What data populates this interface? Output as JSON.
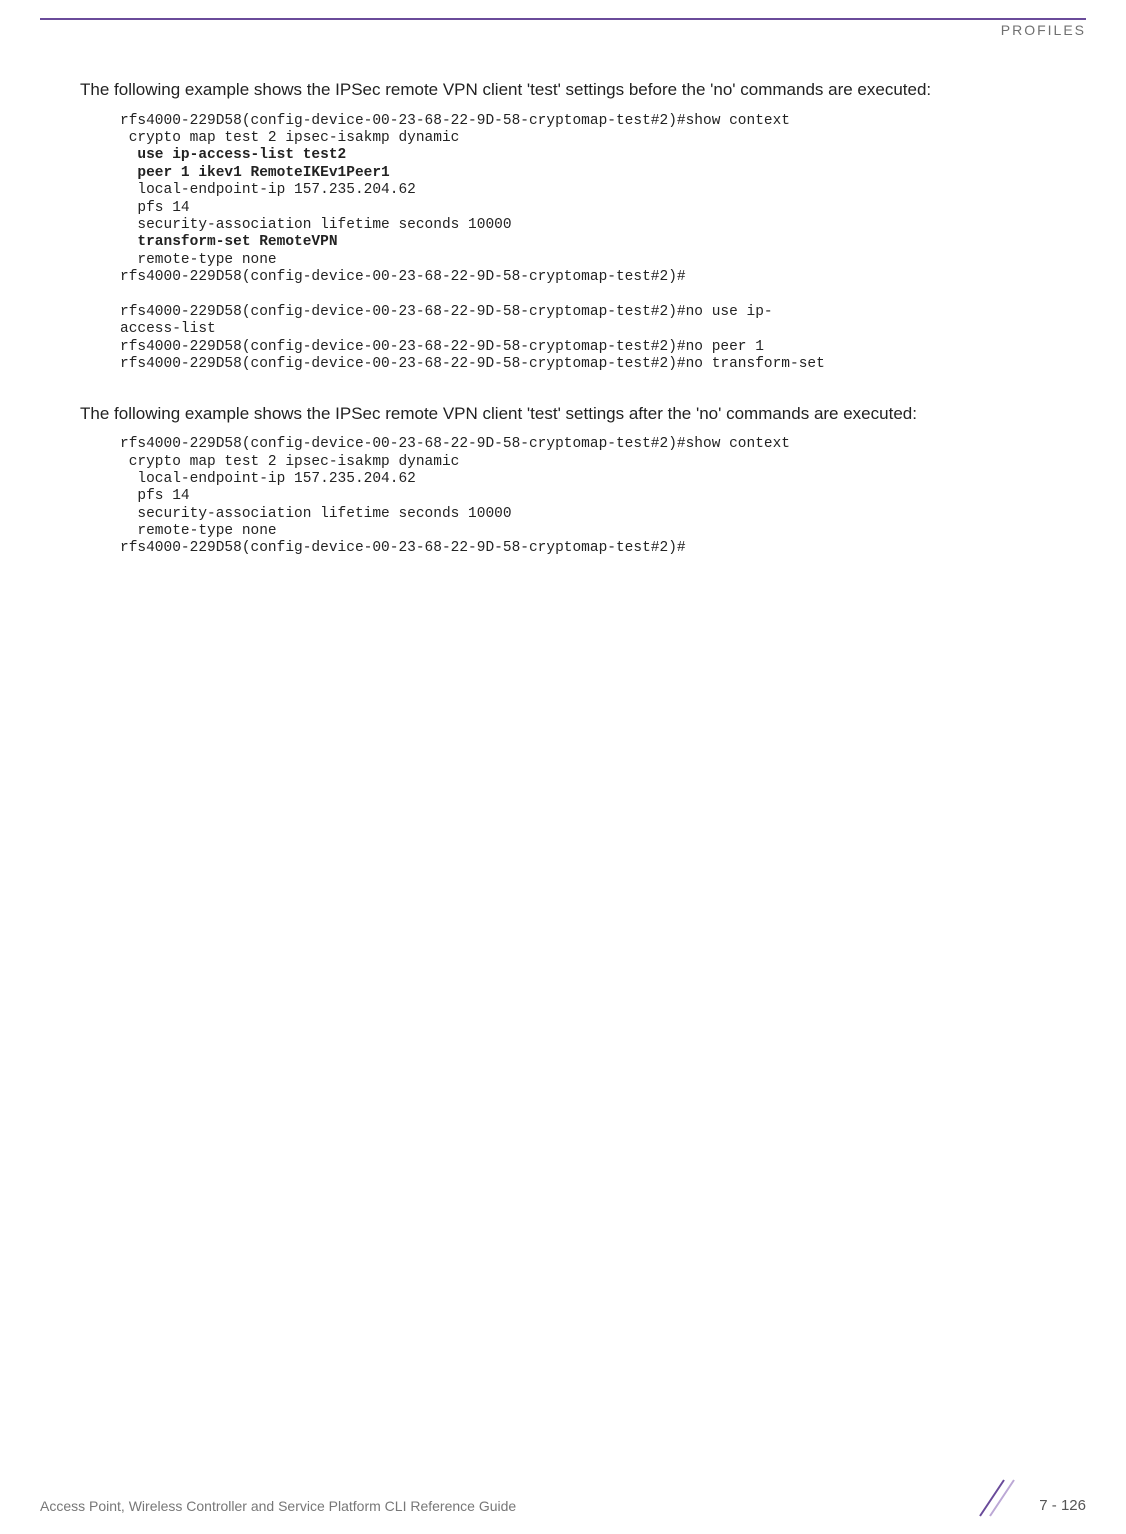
{
  "header": {
    "section": "PROFILES"
  },
  "body": {
    "para1": "The following example shows the IPSec remote VPN client 'test' settings before the 'no' commands are executed:",
    "code1": {
      "l1": "rfs4000-229D58(config-device-00-23-68-22-9D-58-cryptomap-test#2)#show context",
      "l2": " crypto map test 2 ipsec-isakmp dynamic",
      "l3": "  use ip-access-list test2",
      "l4": "  peer 1 ikev1 RemoteIKEv1Peer1",
      "l5": "  local-endpoint-ip 157.235.204.62",
      "l6": "  pfs 14",
      "l7": "  security-association lifetime seconds 10000",
      "l8": "  transform-set RemoteVPN",
      "l9": "  remote-type none",
      "l10": "rfs4000-229D58(config-device-00-23-68-22-9D-58-cryptomap-test#2)#",
      "l11": "",
      "l12": "rfs4000-229D58(config-device-00-23-68-22-9D-58-cryptomap-test#2)#no use ip-",
      "l13": "access-list",
      "l14": "rfs4000-229D58(config-device-00-23-68-22-9D-58-cryptomap-test#2)#no peer 1",
      "l15": "rfs4000-229D58(config-device-00-23-68-22-9D-58-cryptomap-test#2)#no transform-set"
    },
    "para2": "The following example shows the IPSec remote VPN client 'test' settings after the 'no' commands are executed:",
    "code2": {
      "l1": "rfs4000-229D58(config-device-00-23-68-22-9D-58-cryptomap-test#2)#show context",
      "l2": " crypto map test 2 ipsec-isakmp dynamic",
      "l3": "  local-endpoint-ip 157.235.204.62",
      "l4": "  pfs 14",
      "l5": "  security-association lifetime seconds 10000",
      "l6": "  remote-type none",
      "l7": "rfs4000-229D58(config-device-00-23-68-22-9D-58-cryptomap-test#2)#"
    }
  },
  "footer": {
    "guide": "Access Point, Wireless Controller and Service Platform CLI Reference Guide",
    "page": "7 - 126"
  }
}
